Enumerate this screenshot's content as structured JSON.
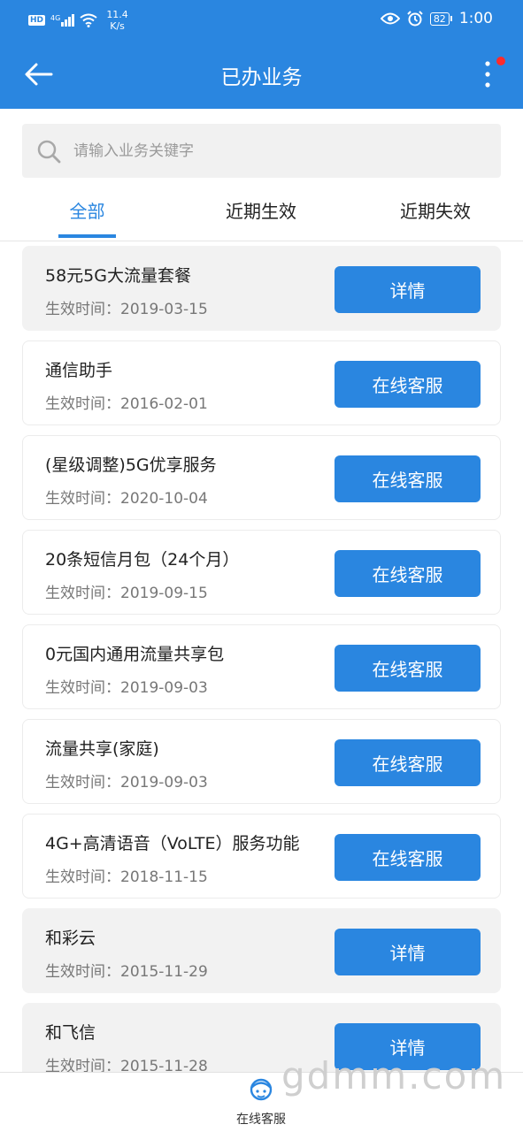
{
  "status_bar": {
    "hd": "HD",
    "network": "4G",
    "speed_value": "11.4",
    "speed_unit": "K/s",
    "battery": "82",
    "time": "1:00",
    "icons": [
      "hd-icon",
      "signal-icon",
      "wifi-icon",
      "eye-icon",
      "alarm-icon",
      "battery-icon"
    ]
  },
  "appbar": {
    "title": "已办业务",
    "back_icon": "arrow-left-icon",
    "more_icon": "more-vertical-icon",
    "notification_dot": true
  },
  "search": {
    "placeholder": "请输入业务关键字",
    "value": ""
  },
  "tabs": [
    {
      "label": "全部",
      "active": true
    },
    {
      "label": "近期生效",
      "active": false
    },
    {
      "label": "近期失效",
      "active": false
    }
  ],
  "services": [
    {
      "name": "58元5G大流量套餐",
      "date_label": "生效时间：2019-03-15",
      "button": "详情",
      "grey": true
    },
    {
      "name": "通信助手",
      "date_label": "生效时间：2016-02-01",
      "button": "在线客服",
      "grey": false
    },
    {
      "name": "(星级调整)5G优享服务",
      "date_label": "生效时间：2020-10-04",
      "button": "在线客服",
      "grey": false
    },
    {
      "name": "20条短信月包（24个月）",
      "date_label": "生效时间：2019-09-15",
      "button": "在线客服",
      "grey": false
    },
    {
      "name": "0元国内通用流量共享包",
      "date_label": "生效时间：2019-09-03",
      "button": "在线客服",
      "grey": false
    },
    {
      "name": "流量共享(家庭)",
      "date_label": "生效时间：2019-09-03",
      "button": "在线客服",
      "grey": false
    },
    {
      "name": "4G+高清语音（VoLTE）服务功能",
      "date_label": "生效时间：2018-11-15",
      "button": "在线客服",
      "grey": false
    },
    {
      "name": "和彩云",
      "date_label": "生效时间：2015-11-29",
      "button": "详情",
      "grey": true
    },
    {
      "name": "和飞信",
      "date_label": "生效时间：2015-11-28",
      "button": "详情",
      "grey": true
    }
  ],
  "bottom_bar": {
    "label": "在线客服",
    "icon": "customer-service-icon"
  },
  "watermark": "gdmm.com",
  "colors": {
    "primary": "#2a86e0",
    "notification": "#ff2b2b",
    "card_grey": "#f2f2f2"
  }
}
